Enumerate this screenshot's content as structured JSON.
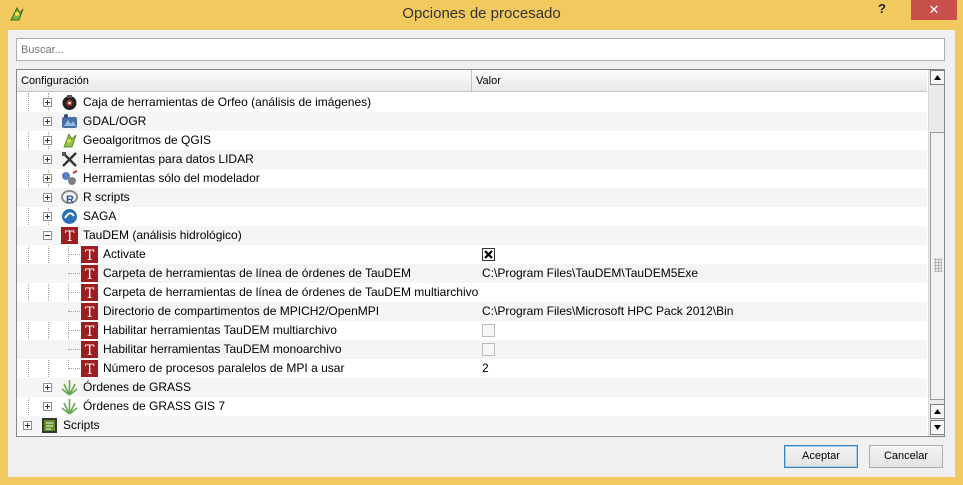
{
  "window": {
    "title": "Opciones de procesado",
    "help": "?",
    "close": "✕"
  },
  "search": {
    "placeholder": "Buscar..."
  },
  "columns": {
    "config": "Configuración",
    "value": "Valor"
  },
  "tree": {
    "orfeo": "Caja de herramientas de Orfeo (análisis de imágenes)",
    "gdal": "GDAL/OGR",
    "qgis": "Geoalgoritmos de QGIS",
    "lidar": "Herramientas para datos LIDAR",
    "modeler": "Herramientas sólo del modelador",
    "rscripts": "R scripts",
    "saga": "SAGA",
    "taudem": {
      "label": "TauDEM (análisis hidrológico)",
      "activate": {
        "label": "Activate",
        "checked": true
      },
      "cmd_folder": {
        "label": "Carpeta de herramientas de línea de órdenes de TauDEM",
        "value": "C:\\Program Files\\TauDEM\\TauDEM5Exe"
      },
      "multi_folder": {
        "label": "Carpeta de herramientas de línea de órdenes de TauDEM multiarchivo",
        "value": ""
      },
      "mpich": {
        "label": "Directorio de compartimentos de MPICH2/OpenMPI",
        "value": "C:\\Program Files\\Microsoft HPC Pack 2012\\Bin"
      },
      "enable_multi": {
        "label": "Habilitar herramientas TauDEM  multiarchivo",
        "checked": false
      },
      "enable_single": {
        "label": "Habilitar herramientas TauDEM monoarchivo",
        "checked": false
      },
      "mpi_procs": {
        "label": "Número de procesos paralelos de MPI a usar",
        "value": "2"
      }
    },
    "grass": "Órdenes de GRASS",
    "grass7": "Órdenes de GRASS GIS 7",
    "scripts": "Scripts"
  },
  "buttons": {
    "ok": "Aceptar",
    "cancel": "Cancelar"
  },
  "icons": {
    "orfeo": "orfeo-toolbox-icon",
    "gdal": "gdal-icon",
    "qgis": "qgis-icon",
    "lidar": "lidar-tools-icon",
    "modeler": "modeler-icon",
    "r": "r-icon",
    "saga": "saga-icon",
    "taudem": "taudem-icon",
    "grass": "grass-icon",
    "scripts": "scripts-icon"
  },
  "colors": {
    "titlebar": "#f1c95e",
    "close": "#c7504b",
    "taudem": "#9c1e1e"
  }
}
